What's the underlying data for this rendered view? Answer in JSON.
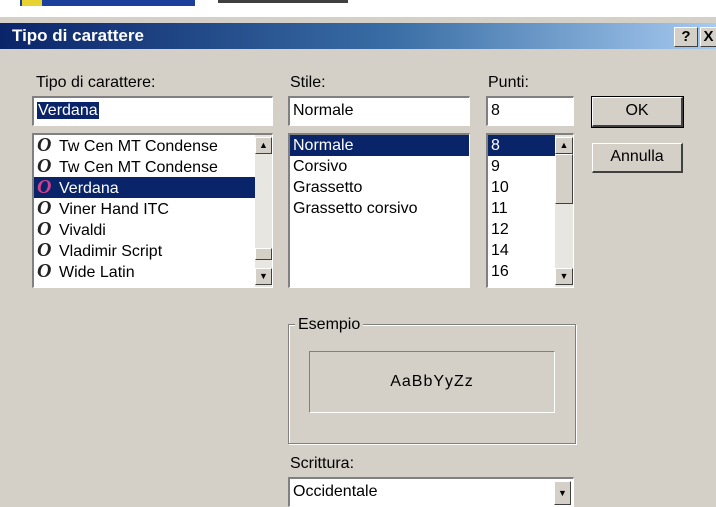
{
  "window": {
    "title": "Tipo di carattere",
    "help_label": "?",
    "close_label": "X"
  },
  "font": {
    "label": "Tipo di carattere:",
    "value": "Verdana",
    "icon": "truetype-font-icon",
    "items": [
      {
        "label": "Tw Cen MT Condense",
        "selected": false
      },
      {
        "label": "Tw Cen MT Condense",
        "selected": false
      },
      {
        "label": "Verdana",
        "selected": true
      },
      {
        "label": "Viner Hand ITC",
        "selected": false
      },
      {
        "label": "Vivaldi",
        "selected": false
      },
      {
        "label": "Vladimir Script",
        "selected": false
      },
      {
        "label": "Wide Latin",
        "selected": false
      }
    ]
  },
  "style": {
    "label": "Stile:",
    "value": "Normale",
    "items": [
      {
        "label": "Normale",
        "selected": true
      },
      {
        "label": "Corsivo",
        "selected": false
      },
      {
        "label": "Grassetto",
        "selected": false
      },
      {
        "label": "Grassetto corsivo",
        "selected": false
      }
    ]
  },
  "size": {
    "label": "Punti:",
    "value": "8",
    "items": [
      {
        "label": "8",
        "selected": true
      },
      {
        "label": "9",
        "selected": false
      },
      {
        "label": "10",
        "selected": false
      },
      {
        "label": "11",
        "selected": false
      },
      {
        "label": "12",
        "selected": false
      },
      {
        "label": "14",
        "selected": false
      },
      {
        "label": "16",
        "selected": false
      }
    ]
  },
  "buttons": {
    "ok": "OK",
    "cancel": "Annulla"
  },
  "sample": {
    "label": "Esempio",
    "text": "AaBbYyZz"
  },
  "script": {
    "label": "Scrittura:",
    "value": "Occidentale"
  },
  "colors": {
    "selection": "#0a246a",
    "face": "#d4d0c8"
  }
}
